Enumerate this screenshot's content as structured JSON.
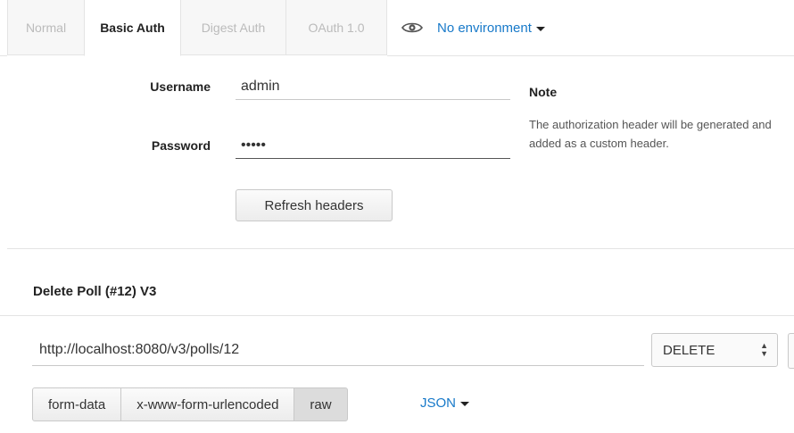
{
  "auth": {
    "tabs": [
      {
        "label": "Normal"
      },
      {
        "label": "Basic Auth"
      },
      {
        "label": "Digest Auth"
      },
      {
        "label": "OAuth 1.0"
      }
    ],
    "environment": {
      "label": "No environment",
      "icon": "eye-icon"
    },
    "form": {
      "username_label": "Username",
      "username_value": "admin",
      "password_label": "Password",
      "password_value": "•••••",
      "refresh_button": "Refresh headers"
    },
    "note": {
      "title": "Note",
      "text": "The authorization header will be generated and added as a custom header."
    }
  },
  "request": {
    "title": "Delete Poll (#12) V3",
    "url": "http://localhost:8080/v3/polls/12",
    "method": "DELETE",
    "body_types": [
      {
        "label": "form-data"
      },
      {
        "label": "x-www-form-urlencoded"
      },
      {
        "label": "raw"
      }
    ],
    "format_dropdown": "JSON"
  },
  "colors": {
    "link": "#1779c9",
    "border": "#e4e4e4",
    "active_button": "#dcdcdc"
  }
}
